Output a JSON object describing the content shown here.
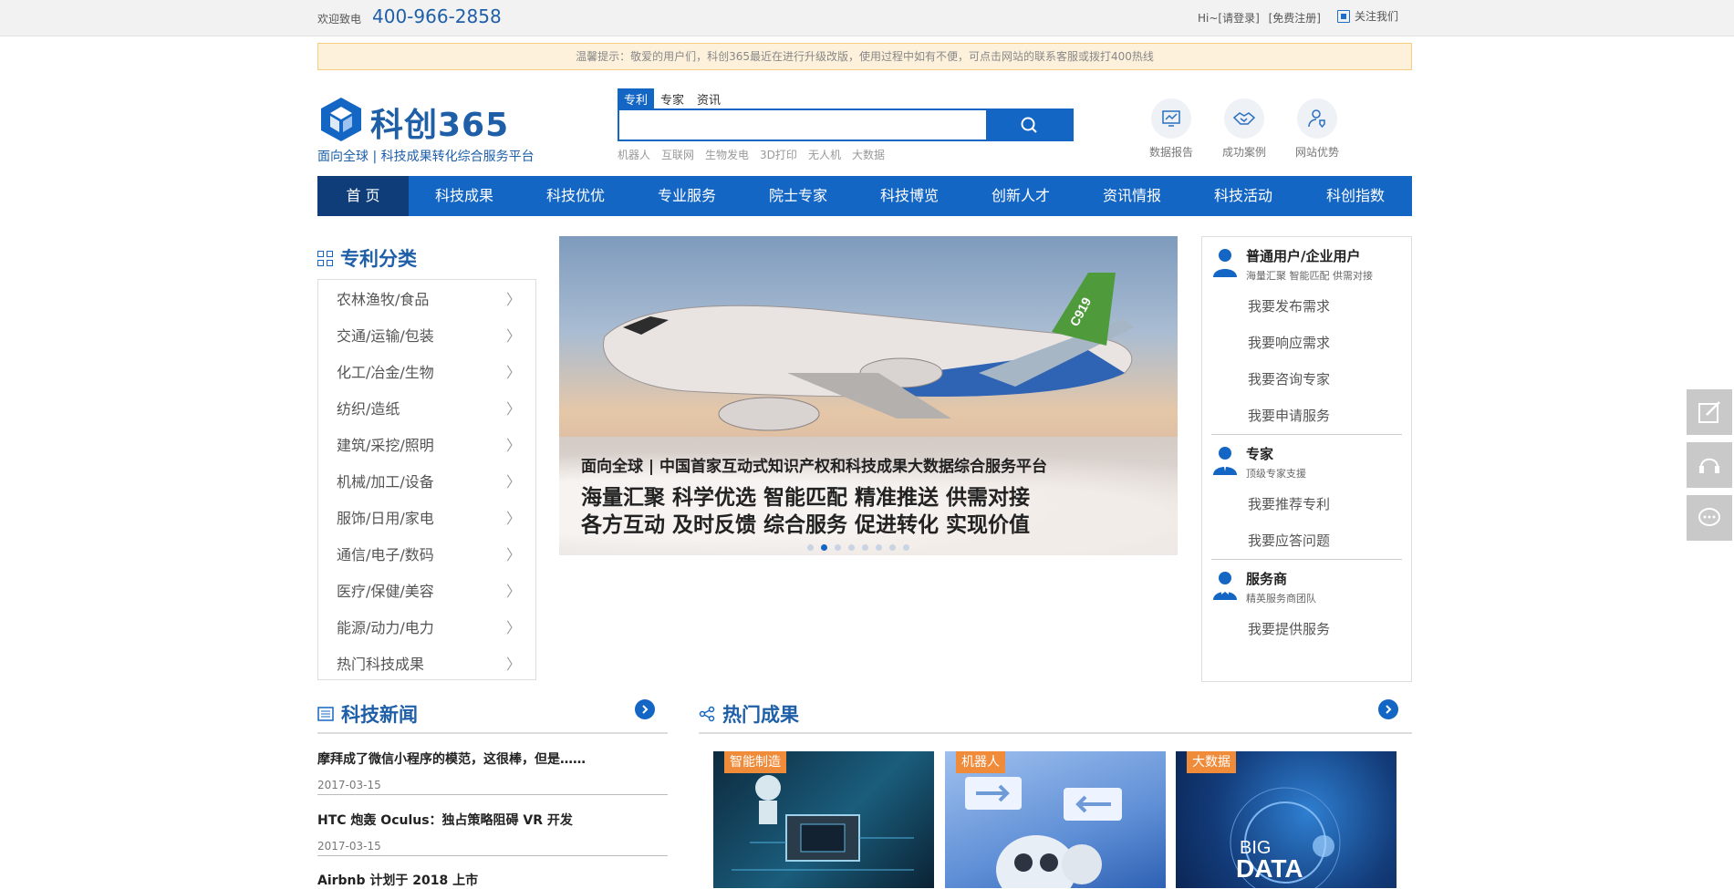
{
  "topbar": {
    "welcome": "欢迎致电",
    "phone": "400-966-2858",
    "login": "Hi~[请登录]",
    "register": "[免费注册]",
    "follow": "关注我们"
  },
  "notice": "温馨提示：敬爱的用户们，科创365最近在进行升级改版，使用过程中如有不便，可点击网站的联系客服或拨打400热线",
  "logo": {
    "brand": "科创365",
    "slogan": "面向全球 | 科技成果转化综合服务平台"
  },
  "search": {
    "tabs": [
      "专利",
      "专家",
      "资讯"
    ],
    "active_tab": "专利",
    "input_value": "",
    "hot_words": [
      "机器人",
      "互联网",
      "生物发电",
      "3D打印",
      "无人机",
      "大数据"
    ]
  },
  "quick_links": [
    {
      "label": "数据报告",
      "icon": "chart-icon"
    },
    {
      "label": "成功案例",
      "icon": "handshake-icon"
    },
    {
      "label": "网站优势",
      "icon": "user-shield-icon"
    }
  ],
  "nav": {
    "items": [
      "首 页",
      "科技成果",
      "科技优优",
      "专业服务",
      "院士专家",
      "科技博览",
      "创新人才",
      "资讯情报",
      "科技活动",
      "科创指数"
    ],
    "active": "首 页"
  },
  "category": {
    "title": "专利分类",
    "items": [
      "农林渔牧/食品",
      "交通/运输/包装",
      "化工/冶金/生物",
      "纺织/造纸",
      "建筑/采挖/照明",
      "机械/加工/设备",
      "服饰/日用/家电",
      "通信/电子/数码",
      "医疗/保健/美容",
      "能源/动力/电力",
      "热门科技成果"
    ]
  },
  "banner": {
    "line1": "面向全球 | 中国首家互动式知识产权和科技成果大数据综合服务平台",
    "line2": "海量汇聚  科学优选  智能匹配  精准推送  供需对接",
    "line3": "各方互动  及时反馈  综合服务  促进转化  实现价值",
    "plane_marking": "C919",
    "dots_total": 8,
    "dots_active": 2
  },
  "users": [
    {
      "title": "普通用户/企业用户",
      "sub": "海量汇聚 智能匹配 供需对接",
      "links": [
        "我要发布需求",
        "我要响应需求",
        "我要咨询专家",
        "我要申请服务"
      ]
    },
    {
      "title": "专家",
      "sub": "顶级专家支援",
      "links": [
        "我要推荐专利",
        "我要应答问题"
      ]
    },
    {
      "title": "服务商",
      "sub": "精英服务商团队",
      "links": [
        "我要提供服务"
      ]
    }
  ],
  "news": {
    "title": "科技新闻",
    "items": [
      {
        "title": "摩拜成了微信小程序的模范，这很棒，但是……",
        "date": "2017-03-15"
      },
      {
        "title": "HTC 炮轰 Oculus：独占策略阻碍 VR 开发",
        "date": "2017-03-15"
      },
      {
        "title": "Airbnb 计划于 2018 上市",
        "date": ""
      }
    ]
  },
  "hot": {
    "title": "热门成果",
    "cards": [
      {
        "tag": "智能制造"
      },
      {
        "tag": "机器人"
      },
      {
        "tag": "大数据",
        "art_text_1": "BIG",
        "art_text_2": "DATA"
      }
    ]
  },
  "colors": {
    "primary": "#1466c4",
    "nav_active": "#0e3d7a",
    "accent": "#f08b3a"
  }
}
